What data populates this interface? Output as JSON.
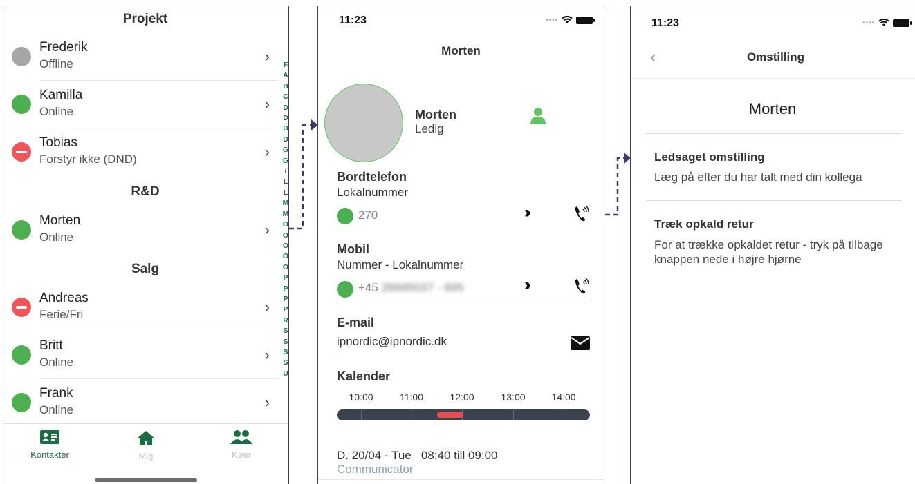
{
  "phone1": {
    "sections": {
      "projekt": "Projekt",
      "rd": "R&D",
      "salg": "Salg"
    },
    "contacts": [
      {
        "name": "Frederik",
        "status": "Offline"
      },
      {
        "name": "Kamilla",
        "status": "Online"
      },
      {
        "name": "Tobias",
        "status": "Forstyr ikke (DND)"
      },
      {
        "name": "Morten",
        "status": "Online"
      },
      {
        "name": "Andreas",
        "status": "Ferie/Fri"
      },
      {
        "name": "Britt",
        "status": "Online"
      },
      {
        "name": "Frank",
        "status": "Online"
      }
    ],
    "index_letters": [
      "F",
      "A",
      "B",
      "C",
      "D",
      "D",
      "D",
      "D",
      "G",
      "G",
      "i",
      "L",
      "L",
      "M",
      "M",
      "O",
      "O",
      "O",
      "O",
      "O",
      "P",
      "P",
      "P",
      "P",
      "R",
      "S",
      "S",
      "S",
      "S",
      "U"
    ],
    "tabs": [
      {
        "label": "Kontakter",
        "icon": "contact-card-icon"
      },
      {
        "label": "Mig",
        "icon": "home-icon"
      },
      {
        "label": "Køer",
        "icon": "people-icon"
      }
    ],
    "colors": {
      "accent": "#1d6b45",
      "online": "#4caf50",
      "offline": "#a6a6a6",
      "dnd": "#f0555a"
    }
  },
  "phone2": {
    "time": "11:23",
    "title": "Morten",
    "profile": {
      "name": "Morten",
      "status": "Ledig"
    },
    "desk": {
      "title": "Bordtelefon",
      "sub": "Lokalnummer",
      "number": "270"
    },
    "mobile": {
      "title": "Mobil",
      "sub": "Nummer - Lokalnummer",
      "prefix": "+45",
      "number_masked": "26685037 - 695"
    },
    "email": {
      "title": "E-mail",
      "address": "ipnordic@ipnordic.dk"
    },
    "calendar": {
      "title": "Kalender",
      "ticks": [
        "10:00",
        "11:00",
        "12:00",
        "13:00",
        "14:00"
      ],
      "event_line": "D. 20/04 - Tue   08:40 till 09:00",
      "event_source": "Communicator"
    }
  },
  "phone3": {
    "time": "11:23",
    "title": "Omstilling",
    "target": "Morten",
    "options": [
      {
        "title": "Ledsaget omstilling",
        "desc": "Læg på efter du har talt med din kollega"
      },
      {
        "title": "Træk opkald retur",
        "desc": "For at trække opkaldet retur - tryk på tilbage knappen nede i højre hjørne"
      }
    ]
  }
}
